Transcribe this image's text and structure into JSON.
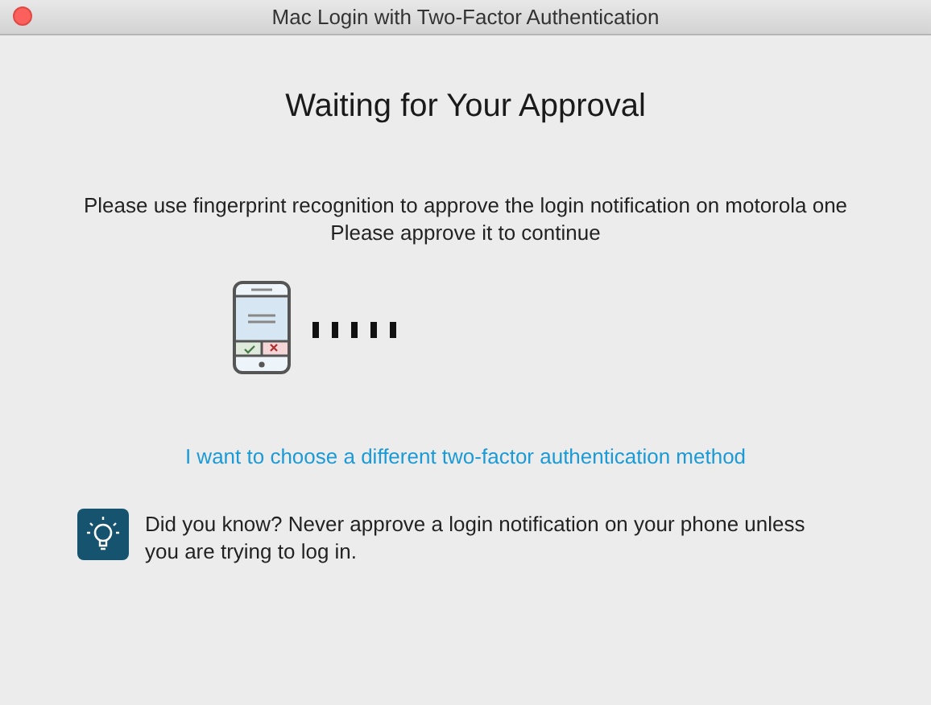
{
  "window": {
    "title": "Mac Login with Two-Factor Authentication"
  },
  "heading": "Waiting for Your Approval",
  "instructions": [
    "Please use fingerprint recognition to approve the login notification on motorola one",
    "Please approve it to continue"
  ],
  "alternative_link": "I want to choose a different two-factor authentication method",
  "tip": {
    "text": "Did you know? Never approve a login notification on your phone unless you are trying to log in."
  }
}
